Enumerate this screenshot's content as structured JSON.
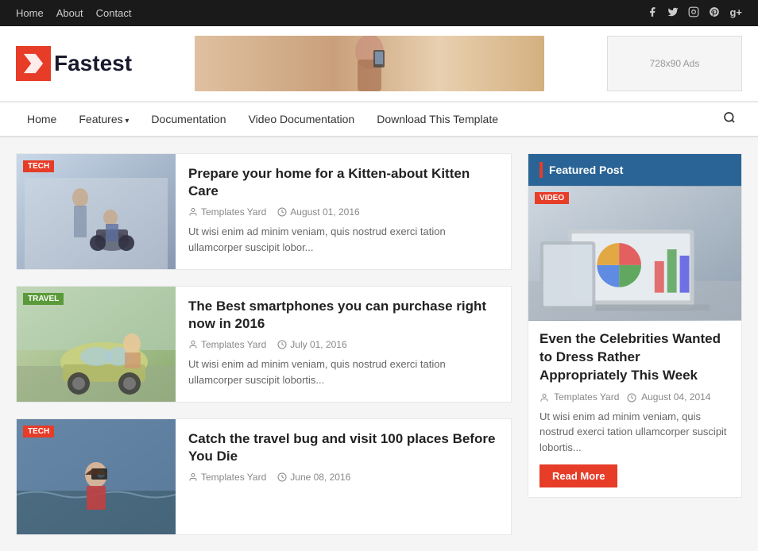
{
  "topbar": {
    "nav": [
      {
        "label": "Home",
        "href": "#"
      },
      {
        "label": "About",
        "href": "#"
      },
      {
        "label": "Contact",
        "href": "#"
      }
    ],
    "social": [
      "f",
      "t",
      "in",
      "p",
      "g+"
    ]
  },
  "header": {
    "logo_text": "Fastest",
    "ads_label": "728x90 Ads"
  },
  "main_nav": {
    "items": [
      {
        "label": "Home",
        "arrow": false
      },
      {
        "label": "Features",
        "arrow": true
      },
      {
        "label": "Documentation",
        "arrow": false
      },
      {
        "label": "Video Documentation",
        "arrow": false
      },
      {
        "label": "Download This Template",
        "arrow": false
      }
    ]
  },
  "articles": [
    {
      "tag": "TECH",
      "tag_class": "tech",
      "title": "Prepare your home for a Kitten-about Kitten Care",
      "author": "Templates Yard",
      "date": "August 01, 2016",
      "excerpt": "Ut wisi enim ad minim veniam, quis nostrud exerci tation ullamcorper suscipit lobor..."
    },
    {
      "tag": "TRAVEL",
      "tag_class": "travel",
      "title": "The Best smartphones you can purchase right now in 2016",
      "author": "Templates Yard",
      "date": "July 01, 2016",
      "excerpt": "Ut wisi enim ad minim veniam, quis nostrud exerci tation ullamcorper suscipit lobortis..."
    },
    {
      "tag": "TECH",
      "tag_class": "tech",
      "title": "Catch the travel bug and visit 100 places Before You Die",
      "author": "Templates Yard",
      "date": "June 08, 2016",
      "excerpt": ""
    }
  ],
  "sidebar": {
    "featured_post": {
      "header": "Featured Post",
      "video_tag": "VIDEO",
      "title": "Even the Celebrities Wanted to Dress Rather Appropriately This Week",
      "author": "Templates Yard",
      "date": "August 04, 2014",
      "excerpt": "Ut wisi enim ad minim veniam, quis nostrud exerci tation ullamcorper suscipit lobortis...",
      "read_more": "Read More"
    }
  },
  "icons": {
    "user": "👤",
    "clock": "🕐",
    "search": "🔍",
    "facebook": "f",
    "twitter": "t",
    "instagram": "in",
    "pinterest": "p",
    "google_plus": "g+"
  }
}
